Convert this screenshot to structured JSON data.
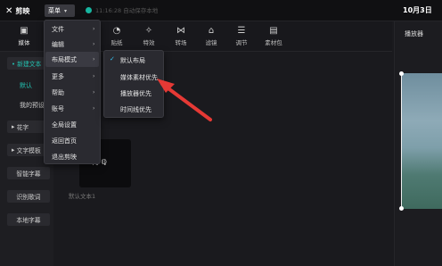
{
  "app": {
    "name": "剪映",
    "menu_label": "菜单",
    "autosave": "11:16:28 自动保存本地",
    "date": "10月3日"
  },
  "toolbar": {
    "items": [
      {
        "label": "媒体",
        "icon": "media-icon"
      },
      {
        "label": "贴纸",
        "icon": "sticker-icon"
      },
      {
        "label": "特效",
        "icon": "effects-icon"
      },
      {
        "label": "转场",
        "icon": "transition-icon"
      },
      {
        "label": "滤镜",
        "icon": "filter-icon"
      },
      {
        "label": "调节",
        "icon": "adjust-icon"
      },
      {
        "label": "素材包",
        "icon": "package-icon"
      }
    ]
  },
  "sidebar": {
    "new_text": "• 新建文本",
    "default": "默认",
    "my_presets": "我的预设",
    "huazi": "花字",
    "text_template": "文字模板",
    "smart_subtitle": "智能字幕",
    "recognize_lyrics": "识别歌词",
    "local_subtitle": "本地字幕"
  },
  "content": {
    "thumb_text": "默认文本1",
    "thumb_overlay": "再 ℚ"
  },
  "player": {
    "title": "播放器"
  },
  "menu": {
    "items": [
      "文件",
      "编辑",
      "布局模式",
      "更多",
      "帮助",
      "账号",
      "全局设置",
      "返回首页",
      "退出剪映"
    ]
  },
  "submenu": {
    "items": [
      "默认布局",
      "媒体素材优先",
      "播放器优先",
      "时间线优先"
    ]
  },
  "colors": {
    "accent": "#23c3b2",
    "arrow": "#e53935",
    "check": "#35c4f4"
  }
}
